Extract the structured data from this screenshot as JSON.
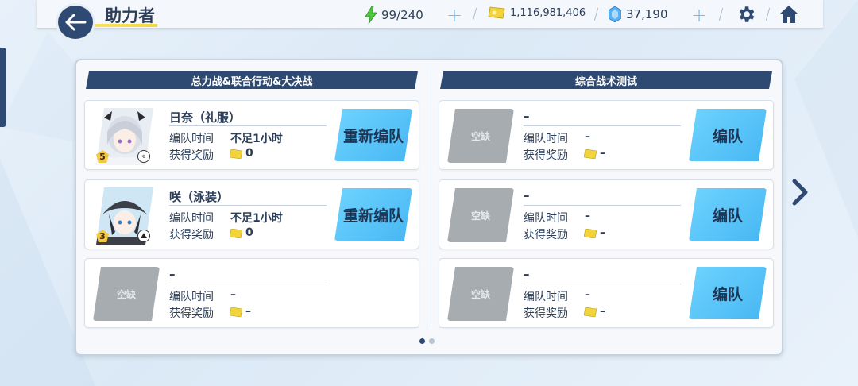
{
  "header": {
    "title": "助力者",
    "ap": "99/240",
    "credits": "1,116,981,406",
    "gems": "37,190"
  },
  "sections": {
    "left_title": "总力战&联合行动&大决战",
    "right_title": "综合战术测试"
  },
  "labels": {
    "time": "编队时间",
    "reward": "获得奖励",
    "empty": "空缺",
    "dash": "–"
  },
  "left_cards": [
    {
      "name": "日奈（礼服）",
      "time": "不足1小时",
      "reward": "0",
      "star": "5",
      "button": "重新编队"
    },
    {
      "name": "咲（泳装）",
      "time": "不足1小时",
      "reward": "0",
      "star": "3",
      "button": "重新编队"
    },
    {
      "name": "–",
      "time": "–",
      "reward": "–"
    }
  ],
  "right_cards": [
    {
      "name": "–",
      "time": "–",
      "reward": "–",
      "button": "编队"
    },
    {
      "name": "–",
      "time": "–",
      "reward": "–",
      "button": "编队"
    },
    {
      "name": "–",
      "time": "–",
      "reward": "–",
      "button": "编队"
    }
  ],
  "colors": {
    "navy": "#2f4a72",
    "button_blue": "#46b7f2",
    "ap_green": "#4ccb3a",
    "credit_yellow": "#f2d43a",
    "gem_blue": "#5ab0f0"
  },
  "pagination": {
    "current": 1,
    "total": 2
  }
}
